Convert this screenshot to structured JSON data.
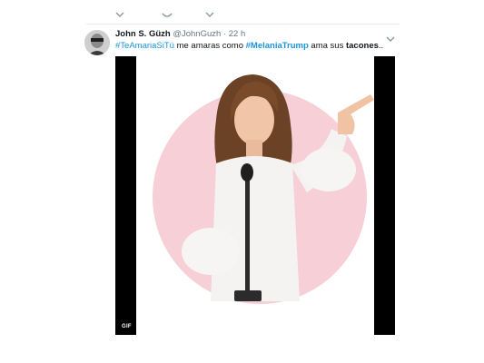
{
  "tweet": {
    "display_name": "John S. Güzh",
    "handle": "@JohnGuzh",
    "separator": "·",
    "time": "22 h",
    "text_parts": {
      "hashtag1": "#TeAmariaSiTú",
      "middle": " me amaras como ",
      "hashtag2": "#MelaniaTrump",
      "after": " ama sus ",
      "bold_word": "tacones",
      "end": ".."
    },
    "media_badge": "GIF"
  },
  "icons": {
    "top_actions": [
      "reply-icon",
      "retweet-icon",
      "like-icon"
    ],
    "menu": "chevron-down-icon"
  },
  "colors": {
    "link": "#1b95e0",
    "text": "#14171a",
    "meta": "#657786",
    "circle": "#f6cfd7"
  }
}
